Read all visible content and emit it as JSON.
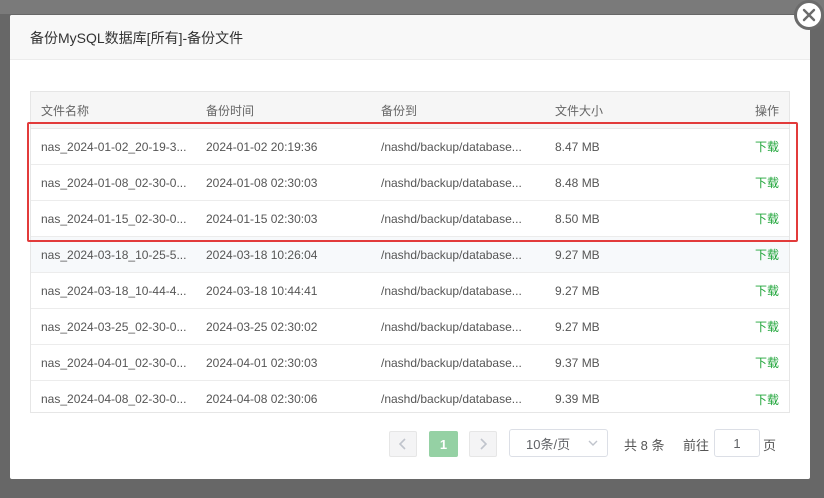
{
  "modal": {
    "title": "备份MySQL数据库[所有]-备份文件"
  },
  "table": {
    "headers": [
      "文件名称",
      "备份时间",
      "备份到",
      "文件大小",
      "操作"
    ],
    "rows": [
      {
        "name": "nas_2024-01-02_20-19-3...",
        "time": "2024-01-02 20:19:36",
        "dest": "/nashd/backup/database...",
        "size": "8.47 MB",
        "action": "下载"
      },
      {
        "name": "nas_2024-01-08_02-30-0...",
        "time": "2024-01-08 02:30:03",
        "dest": "/nashd/backup/database...",
        "size": "8.48 MB",
        "action": "下载"
      },
      {
        "name": "nas_2024-01-15_02-30-0...",
        "time": "2024-01-15 02:30:03",
        "dest": "/nashd/backup/database...",
        "size": "8.50 MB",
        "action": "下载"
      },
      {
        "name": "nas_2024-03-18_10-25-5...",
        "time": "2024-03-18 10:26:04",
        "dest": "/nashd/backup/database...",
        "size": "9.27 MB",
        "action": "下载"
      },
      {
        "name": "nas_2024-03-18_10-44-4...",
        "time": "2024-03-18 10:44:41",
        "dest": "/nashd/backup/database...",
        "size": "9.27 MB",
        "action": "下载"
      },
      {
        "name": "nas_2024-03-25_02-30-0...",
        "time": "2024-03-25 02:30:02",
        "dest": "/nashd/backup/database...",
        "size": "9.27 MB",
        "action": "下载"
      },
      {
        "name": "nas_2024-04-01_02-30-0...",
        "time": "2024-04-01 02:30:03",
        "dest": "/nashd/backup/database...",
        "size": "9.37 MB",
        "action": "下载"
      },
      {
        "name": "nas_2024-04-08_02-30-0...",
        "time": "2024-04-08 02:30:06",
        "dest": "/nashd/backup/database...",
        "size": "9.39 MB",
        "action": "下载"
      }
    ]
  },
  "pagination": {
    "prev_icon": "chevron-left-icon",
    "next_icon": "chevron-right-icon",
    "current_page": "1",
    "page_size": "10条/页",
    "total": "共 8 条",
    "goto_label": "前往",
    "goto_value": "1",
    "page_suffix": "页"
  },
  "colors": {
    "accent": "#20a53a",
    "current_page_bg": "#95d1a4",
    "highlight_border": "#e23b3b"
  }
}
